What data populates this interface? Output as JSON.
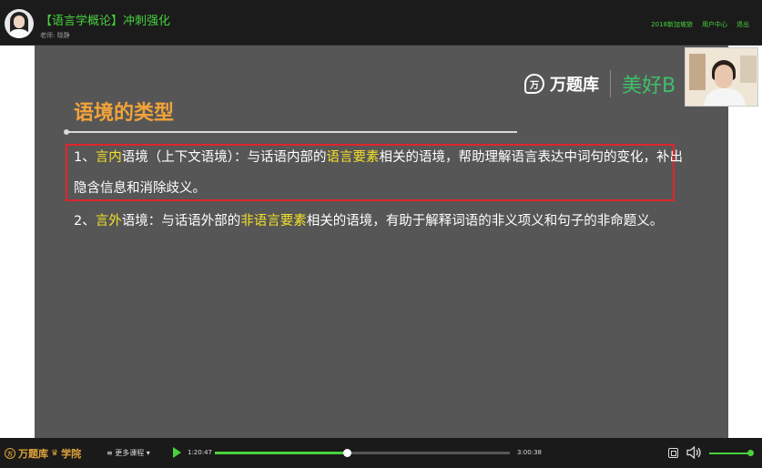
{
  "header": {
    "course_title": "【语言学概论】冲刺强化",
    "teacher": "老师: 晓静",
    "links": [
      "2018新加坡旅",
      "用户中心",
      "退出"
    ]
  },
  "slide": {
    "logo_text": "万题库",
    "logo_mark": "万",
    "slogan": "美好B",
    "title": "语境的类型",
    "point1": {
      "prefix": "1、",
      "highlight": "言内",
      "text1": "语境（上下文语境）：与话语内部的",
      "highlight2": "语言要素",
      "text2": "相关的语境，帮助理解语言表达中词句的变化，补出隐含信息和消除歧义。"
    },
    "point2": {
      "prefix": "2、",
      "highlight": "言外",
      "text1": "语境：与话语外部的",
      "highlight2": "非语言要素",
      "text2": "相关的语境，有助于解释词语的非义项义和句子的非命题义。"
    }
  },
  "controls": {
    "brand": "万题库",
    "brand_suffix": "学院",
    "brand_mark": "万",
    "more_courses": "≡ 更多课程 ▾",
    "current_time": "1:20:47",
    "total_time": "3:00:38",
    "progress_fraction": 0.447,
    "volume_fraction": 0.98
  },
  "colors": {
    "accent": "#47d13d",
    "title_orange": "#f2a33a",
    "highlight_yellow": "#f3e12b",
    "box_red": "#e0262b"
  }
}
